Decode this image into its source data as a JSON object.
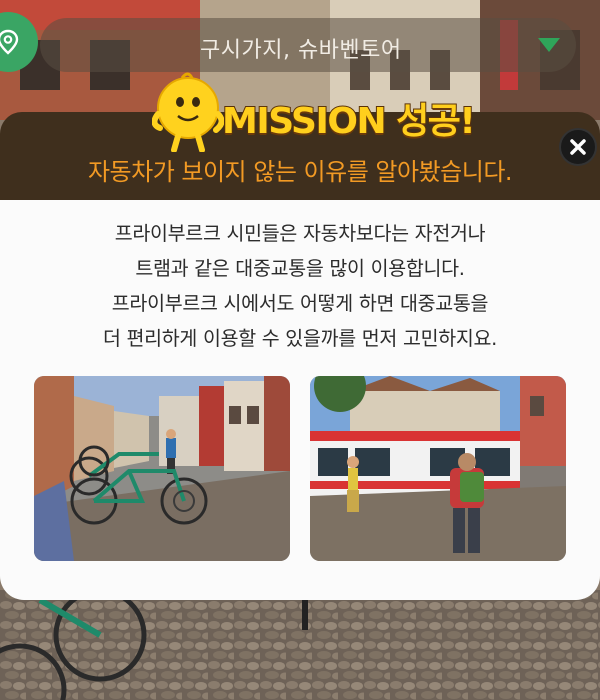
{
  "location": {
    "name": "구시가지, 슈바벤토어"
  },
  "mission": {
    "title": "MISSION 성공!",
    "subtitle": "자동차가 보이지 않는 이유를 알아봤습니다."
  },
  "body": {
    "lines": [
      "프라이부르크 시민들은 자동차보다는 자전거나",
      "트램과 같은 대중교통을 많이 이용합니다.",
      "프라이부르크 시에서도 어떻게 하면 대중교통을",
      "더 편리하게 이용할 수 있을까를 먼저 고민하지요."
    ]
  },
  "icons": {
    "location": "location-pin-icon",
    "dropdown": "chevron-down-icon",
    "close": "close-icon"
  },
  "colors": {
    "header_bg": "#3f2f1d",
    "mission_title": "#ffcf1d",
    "subtitle": "#f29a24",
    "pin": "#3aa564",
    "accent_arrow": "#2fa55a"
  }
}
